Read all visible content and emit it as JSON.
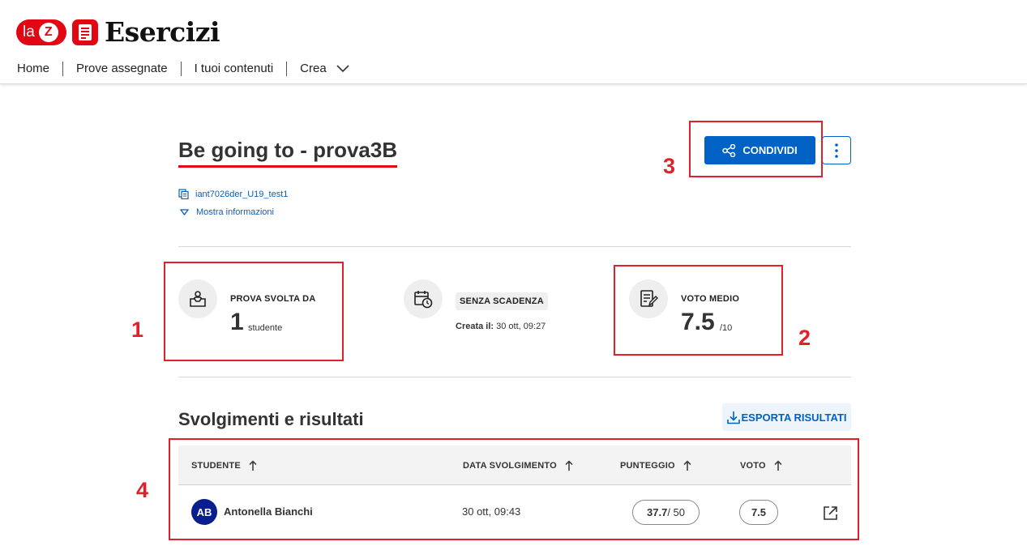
{
  "header": {
    "logo_text": "la",
    "logo_z": "Z",
    "app_title": "Esercizi",
    "nav": [
      {
        "label": "Home"
      },
      {
        "label": "Prove assegnate"
      },
      {
        "label": "I tuoi contenuti"
      },
      {
        "label": "Crea"
      }
    ]
  },
  "test": {
    "title": "Be going to - prova3B",
    "code": "iant7026der_U19_test1",
    "info_link": "Mostra informazioni",
    "share_label": "CONDIVIDI"
  },
  "stats": {
    "done_by_label": "PROVA SVOLTA DA",
    "done_by_value": "1",
    "done_by_unit": "studente",
    "deadline_label": "SENZA SCADENZA",
    "created_label": "Creata il:",
    "created_value": "30 ott, 09:27",
    "avg_label": "VOTO MEDIO",
    "avg_value": "7.5",
    "avg_scale": "/10"
  },
  "results": {
    "title": "Svolgimenti e risultati",
    "export_label": "ESPORTA RISULTATI",
    "columns": [
      "STUDENTE",
      "DATA SVOLGIMENTO",
      "PUNTEGGIO",
      "VOTO"
    ],
    "rows": [
      {
        "initials": "AB",
        "name": "Antonella Bianchi",
        "date": "30 ott, 09:43",
        "score": "37.7",
        "score_max": "/ 50",
        "grade": "7.5"
      }
    ]
  },
  "annotations": [
    "1",
    "2",
    "3",
    "4"
  ],
  "colors": {
    "brand_red": "#e30613",
    "primary_blue": "#0062c4",
    "annotation_red": "#e0202a",
    "avatar_navy": "#0a1f8f"
  }
}
